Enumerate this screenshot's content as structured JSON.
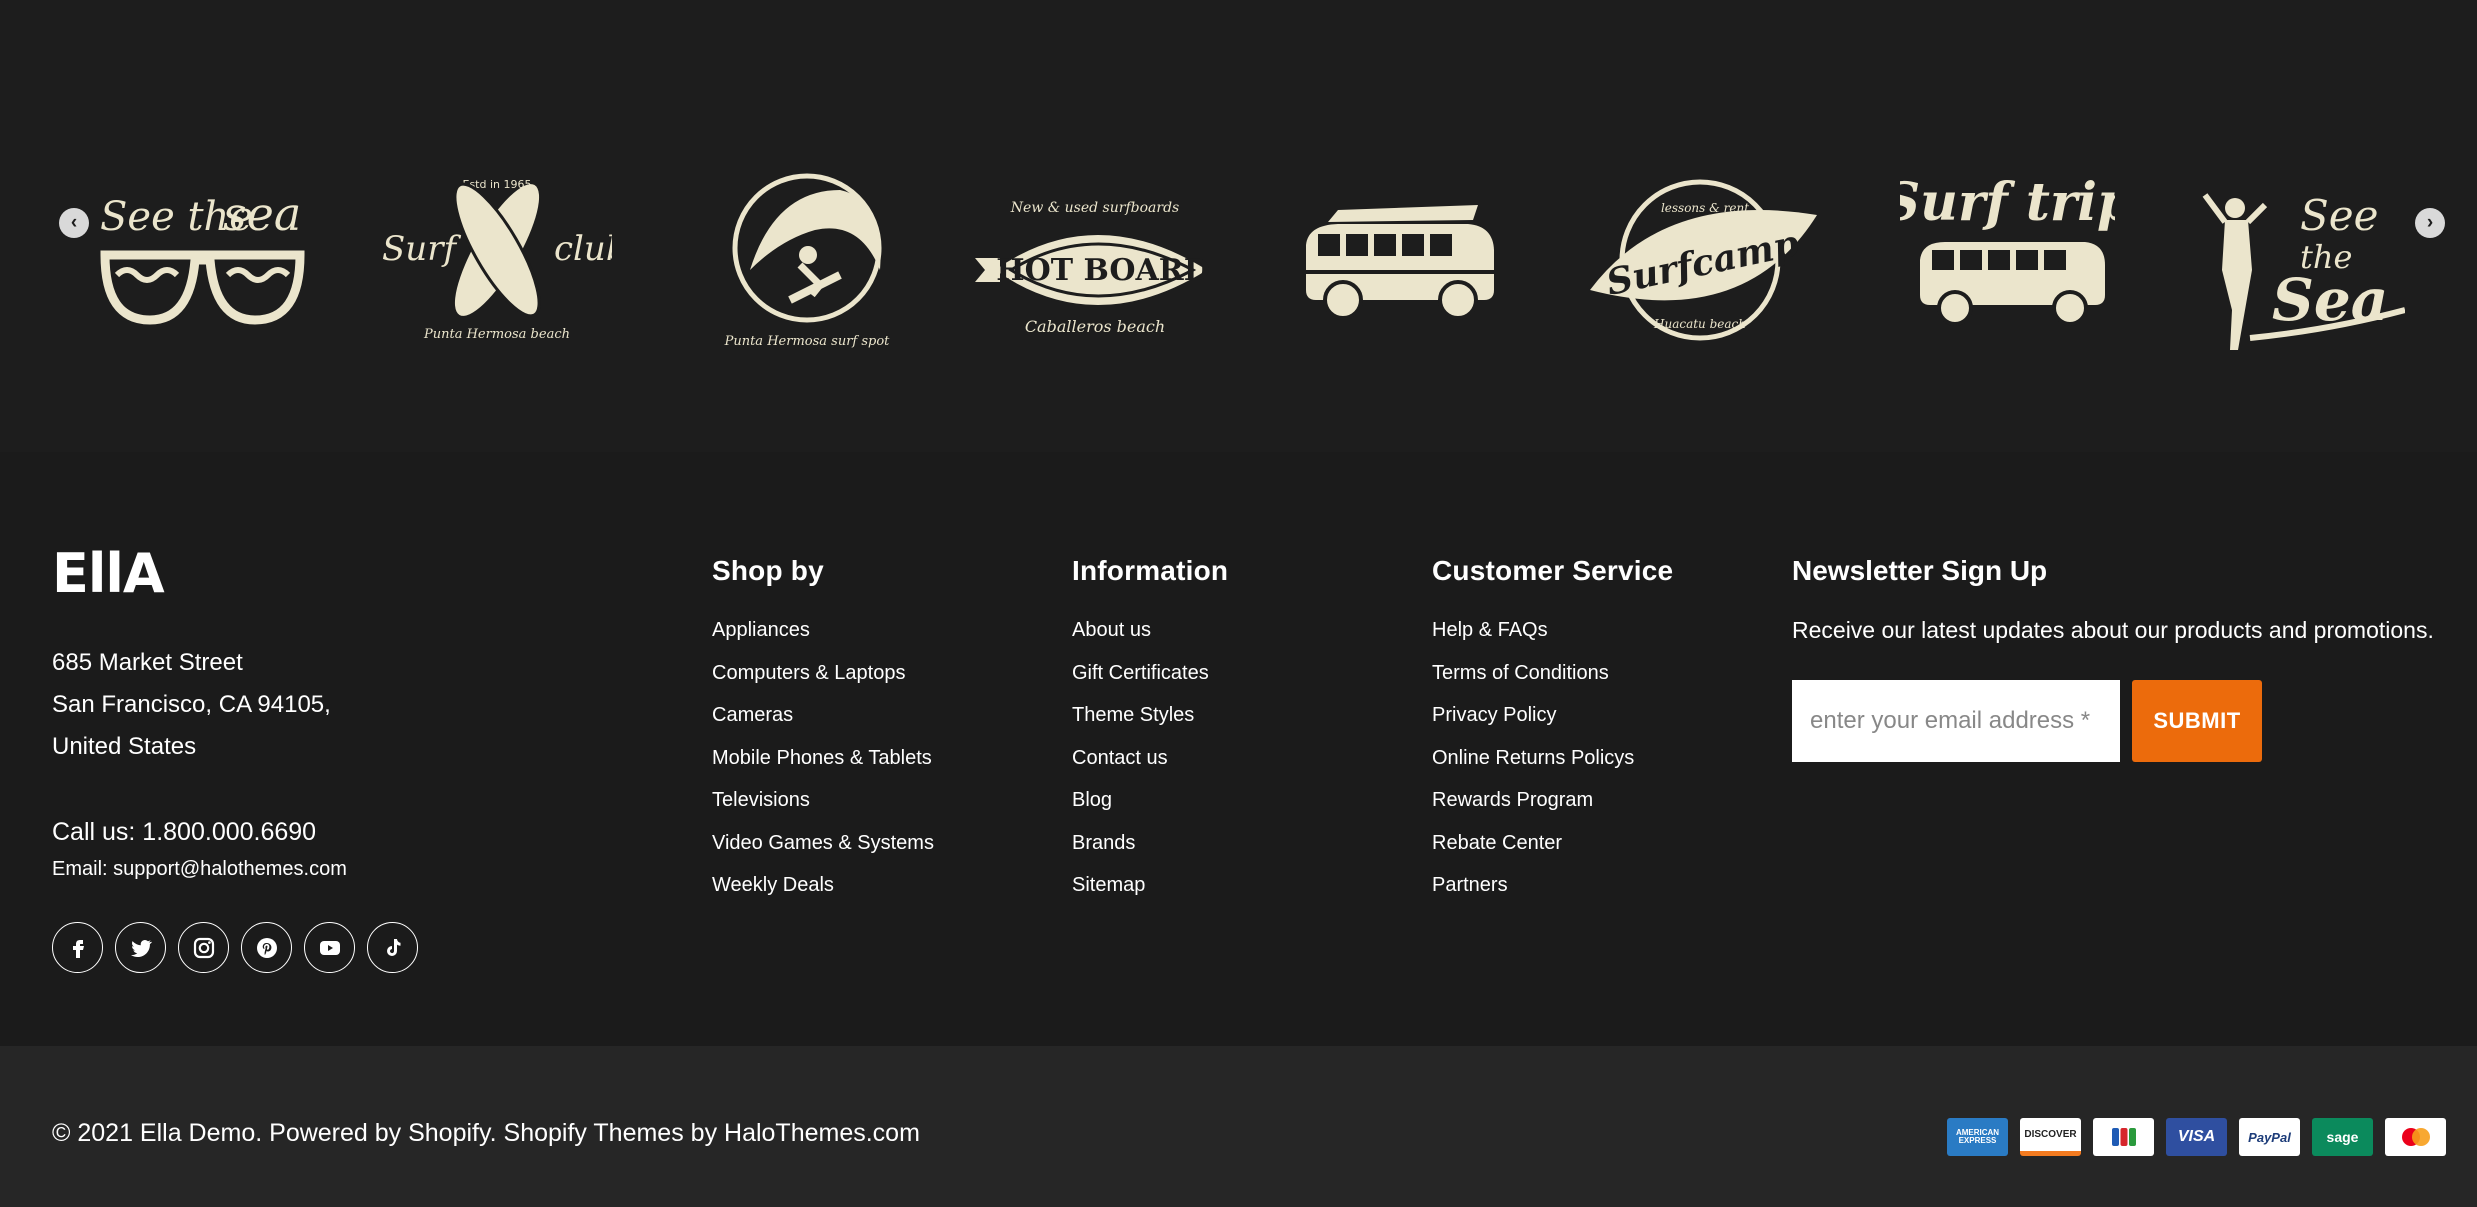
{
  "carousel": {
    "prev_icon": "chevron-left-icon",
    "next_icon": "chevron-right-icon",
    "logos": [
      {
        "name": "see-the-sea-glasses",
        "line1": "See the",
        "line2": "sea"
      },
      {
        "name": "surf-club",
        "top": "Estd in 1965",
        "left": "Surf",
        "right": "club",
        "bottom": "Punta Hermosa beach"
      },
      {
        "name": "surf-spot",
        "bottom": "Punta Hermosa surf spot"
      },
      {
        "name": "hot-board",
        "top": "New & used surfboards",
        "center": "HOT BOARD",
        "bottom": "Caballeros beach"
      },
      {
        "name": "camper-van"
      },
      {
        "name": "surf-camp",
        "top": "lessons & rent",
        "center": "Surfcamp",
        "bottom": "Huacatu beach"
      },
      {
        "name": "surf-trip",
        "title": "Surf trip"
      },
      {
        "name": "see-the-sea-girl",
        "line1": "See",
        "line2": "the",
        "line3": "Sea"
      }
    ]
  },
  "footer": {
    "logo_text": "EllA",
    "address": [
      "685 Market Street",
      "San Francisco, CA 94105,",
      "United States"
    ],
    "phone": "Call us: 1.800.000.6690",
    "email": "Email: support@halothemes.com",
    "socials": [
      "facebook-icon",
      "twitter-icon",
      "instagram-icon",
      "pinterest-icon",
      "youtube-icon",
      "tiktok-icon"
    ],
    "shop_by": {
      "title": "Shop by",
      "items": [
        "Appliances",
        "Computers & Laptops",
        "Cameras",
        "Mobile Phones & Tablets",
        "Televisions",
        "Video Games & Systems",
        "Weekly Deals"
      ]
    },
    "information": {
      "title": "Information",
      "items": [
        "About us",
        "Gift Certificates",
        "Theme Styles",
        "Contact us",
        "Blog",
        "Brands",
        "Sitemap"
      ]
    },
    "customer_service": {
      "title": "Customer Service",
      "items": [
        "Help & FAQs",
        "Terms of Conditions",
        "Privacy Policy",
        "Online Returns Policys",
        "Rewards Program",
        "Rebate Center",
        "Partners"
      ]
    },
    "newsletter": {
      "title": "Newsletter Sign Up",
      "text": "Receive our latest updates about our products and promotions.",
      "placeholder": "enter your email address *",
      "submit": "SUBMIT"
    }
  },
  "bottom": {
    "copyright": "© 2021 Ella Demo. Powered by Shopify. Shopify Themes by HaloThemes.com",
    "payments": [
      {
        "name": "american-express",
        "label": "AMERICAN EXPRESS",
        "bg": "#2a7bc4",
        "fg": "#ffffff"
      },
      {
        "name": "discover",
        "label": "DISCOVER",
        "bg": "#ffffff",
        "fg": "#222222"
      },
      {
        "name": "jcb",
        "label": "",
        "bg": "#ffffff",
        "fg": "#222222"
      },
      {
        "name": "visa",
        "label": "VISA",
        "bg": "#2f4fa0",
        "fg": "#ffffff"
      },
      {
        "name": "paypal",
        "label": "PayPal",
        "bg": "#ffffff",
        "fg": "#1e3d7a"
      },
      {
        "name": "sage",
        "label": "sage",
        "bg": "#0b8a5c",
        "fg": "#ffffff"
      },
      {
        "name": "mastercard",
        "label": "",
        "bg": "#ffffff",
        "fg": "#222222"
      }
    ]
  },
  "colors": {
    "accent": "#ec6b0c",
    "logo_cream": "#ebe5cc",
    "background": "#1b1b1b",
    "bottom_bar": "#262626"
  }
}
